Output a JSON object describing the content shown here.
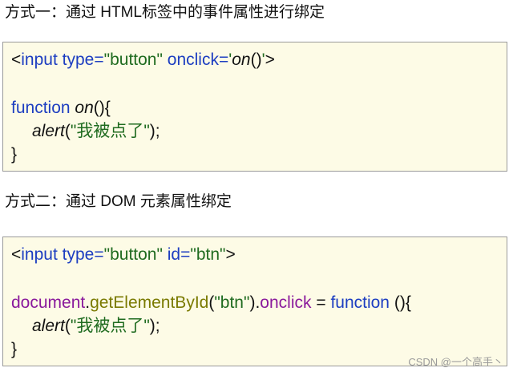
{
  "section1": {
    "heading": "方式一：通过 HTML标签中的事件属性进行绑定",
    "code": {
      "l1_open": "<",
      "l1_tag": "input",
      "l1_sp1": " ",
      "l1_attr1": "type=",
      "l1_val1": "\"button\"",
      "l1_sp2": " ",
      "l1_attr2": "onclick=",
      "l1_q1": "'",
      "l1_fn": "on",
      "l1_paren": "()",
      "l1_q2": "'",
      "l1_close": ">",
      "l3_kw": "function",
      "l3_sp": " ",
      "l3_fn": "on",
      "l3_rest": "(){",
      "l4_fn": "alert",
      "l4_p1": "(",
      "l4_str": "\"我被点了\"",
      "l4_p2": ");",
      "l5_brace": "}"
    }
  },
  "section2": {
    "heading": "方式二：通过 DOM 元素属性绑定",
    "code": {
      "l1_open": "<",
      "l1_tag": "input",
      "l1_sp1": " ",
      "l1_attr1": "type=",
      "l1_val1": "\"button\"",
      "l1_sp2": " ",
      "l1_attr2": "id=",
      "l1_val2": "\"btn\"",
      "l1_close": ">",
      "l3_obj": "document",
      "l3_dot1": ".",
      "l3_method": "getElementById",
      "l3_p1": "(",
      "l3_arg": "\"btn\"",
      "l3_p2": ")",
      "l3_dot2": ".",
      "l3_prop": "onclick",
      "l3_eq": " = ",
      "l3_kw": "function",
      "l3_rest": " (){",
      "l4_fn": "alert",
      "l4_p1": "(",
      "l4_str": "\"我被点了\"",
      "l4_p2": ");",
      "l5_brace": "}"
    }
  },
  "watermark": "CSDN @一个高手丶",
  "colors": {
    "box_background": "#fdfbe6",
    "keyword_blue": "#1d3ec1",
    "string_green": "#1f6b1f",
    "object_purple": "#8a1a9c",
    "method_olive": "#7a7a00"
  }
}
